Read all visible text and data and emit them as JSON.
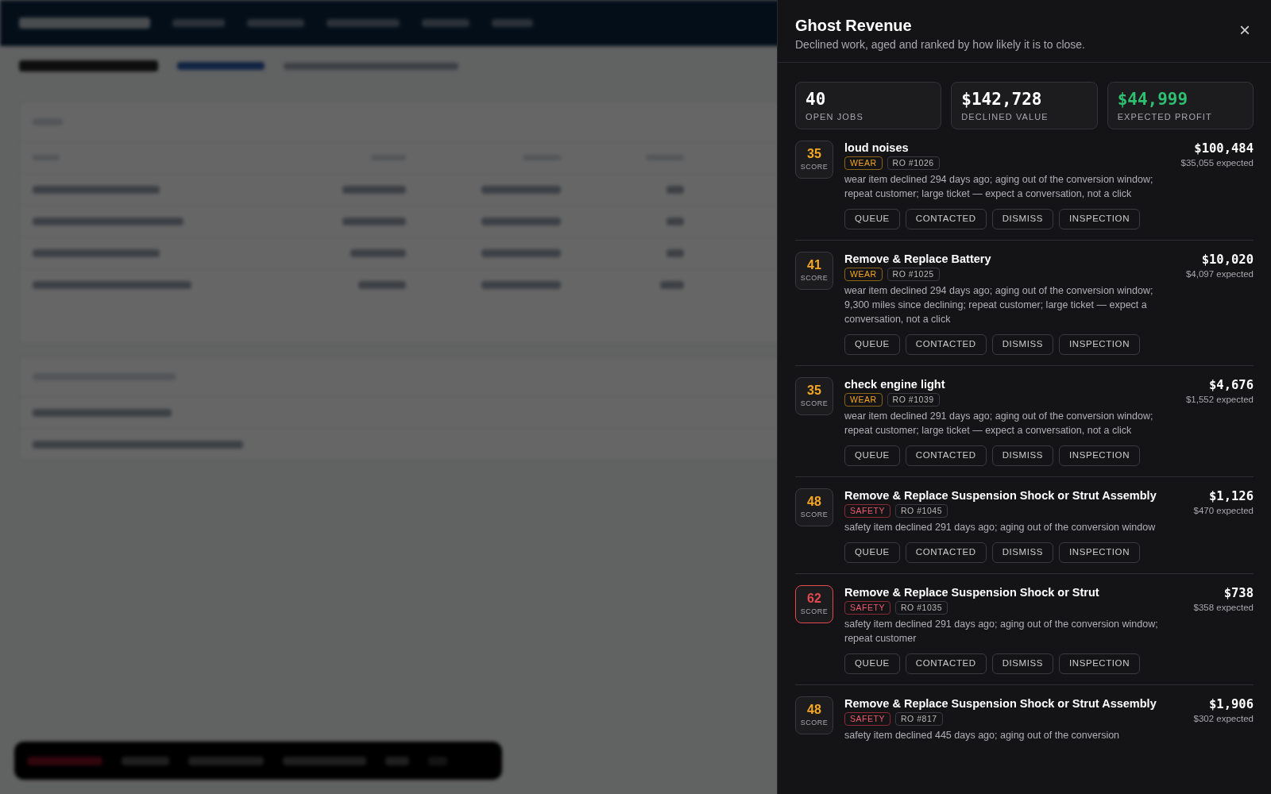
{
  "panel": {
    "title": "Ghost Revenue",
    "subtitle": "Declined work, aged and ranked by how likely it is to close.",
    "close": "×",
    "stats": [
      {
        "value": "40",
        "label": "OPEN JOBS",
        "kind": "plain"
      },
      {
        "value": "$142,728",
        "label": "DECLINED VALUE",
        "kind": "plain"
      },
      {
        "value": "$44,999",
        "label": "EXPECTED PROFIT",
        "kind": "positive"
      }
    ],
    "items": [
      {
        "score": "35",
        "score_label": "SCORE",
        "hot": false,
        "title": "loud noises",
        "kind": "wear",
        "tag": "WEAR",
        "ro": "RO #1026",
        "reason": "wear item declined 294 days ago; aging out of the conversion window; repeat customer; large ticket — expect a conversation, not a click",
        "value": "$100,484",
        "expected": "$35,055 expected",
        "actions": [
          "QUEUE",
          "CONTACTED",
          "DISMISS",
          "INSPECTION"
        ]
      },
      {
        "score": "41",
        "score_label": "SCORE",
        "hot": false,
        "title": "Remove & Replace Battery",
        "kind": "wear",
        "tag": "WEAR",
        "ro": "RO #1025",
        "reason": "wear item declined 294 days ago; aging out of the conversion window; 9,300 miles since declining; repeat customer; large ticket — expect a conversation, not a click",
        "value": "$10,020",
        "expected": "$4,097 expected",
        "actions": [
          "QUEUE",
          "CONTACTED",
          "DISMISS",
          "INSPECTION"
        ]
      },
      {
        "score": "35",
        "score_label": "SCORE",
        "hot": false,
        "title": "check engine light",
        "kind": "wear",
        "tag": "WEAR",
        "ro": "RO #1039",
        "reason": "wear item declined 291 days ago; aging out of the conversion window; repeat customer; large ticket — expect a conversation, not a click",
        "value": "$4,676",
        "expected": "$1,552 expected",
        "actions": [
          "QUEUE",
          "CONTACTED",
          "DISMISS",
          "INSPECTION"
        ]
      },
      {
        "score": "48",
        "score_label": "SCORE",
        "hot": false,
        "title": "Remove & Replace Suspension Shock or Strut Assembly",
        "kind": "safety",
        "tag": "SAFETY",
        "ro": "RO #1045",
        "reason": "safety item declined 291 days ago; aging out of the conversion window",
        "value": "$1,126",
        "expected": "$470 expected",
        "actions": [
          "QUEUE",
          "CONTACTED",
          "DISMISS",
          "INSPECTION"
        ]
      },
      {
        "score": "62",
        "score_label": "SCORE",
        "hot": true,
        "title": "Remove & Replace Suspension Shock or Strut",
        "kind": "safety",
        "tag": "SAFETY",
        "ro": "RO #1035",
        "reason": "safety item declined 291 days ago; aging out of the conversion window; repeat customer",
        "value": "$738",
        "expected": "$358 expected",
        "actions": [
          "QUEUE",
          "CONTACTED",
          "DISMISS",
          "INSPECTION"
        ]
      },
      {
        "score": "48",
        "score_label": "SCORE",
        "hot": false,
        "title": "Remove & Replace Suspension Shock or Strut Assembly",
        "kind": "safety",
        "tag": "SAFETY",
        "ro": "RO #817",
        "reason": "safety item declined 445 days ago; aging out of the conversion",
        "value": "$1,906",
        "expected": "$302 expected"
      }
    ]
  }
}
